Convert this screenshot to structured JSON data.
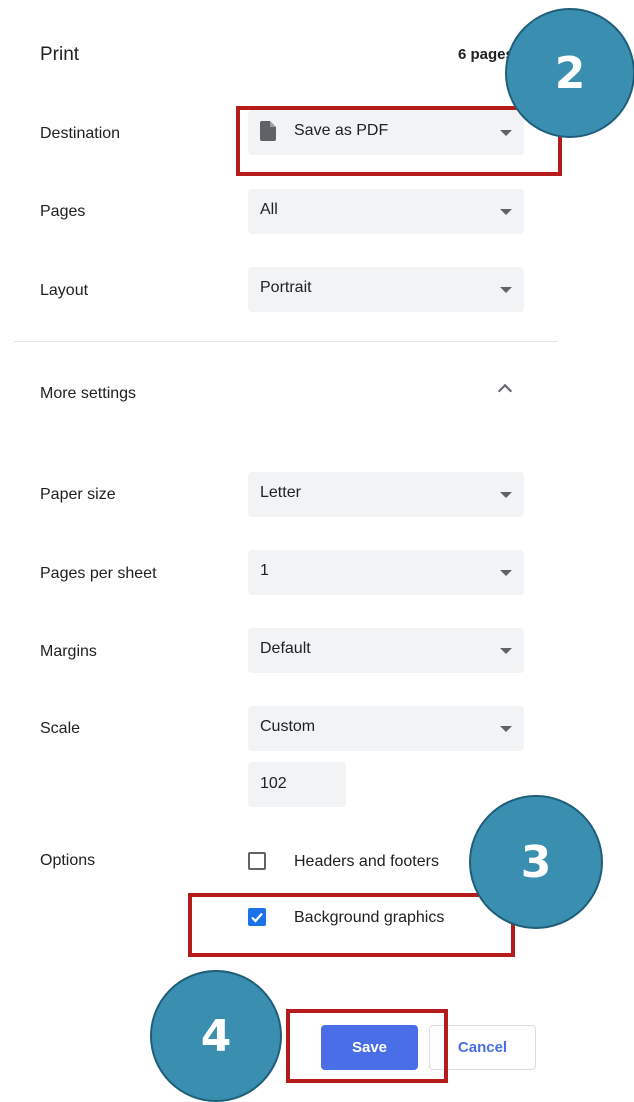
{
  "header": {
    "title": "Print",
    "page_count": "6 pages"
  },
  "destination": {
    "label": "Destination",
    "value": "Save as PDF",
    "icon": "document-icon"
  },
  "pages": {
    "label": "Pages",
    "value": "All"
  },
  "layout": {
    "label": "Layout",
    "value": "Portrait"
  },
  "more_settings": {
    "label": "More settings",
    "icon": "chevron-up-icon"
  },
  "paper_size": {
    "label": "Paper size",
    "value": "Letter"
  },
  "pages_per_sheet": {
    "label": "Pages per sheet",
    "value": "1"
  },
  "margins": {
    "label": "Margins",
    "value": "Default"
  },
  "scale": {
    "label": "Scale",
    "value": "Custom",
    "custom_value": "102"
  },
  "options": {
    "label": "Options",
    "headers_footers": {
      "label": "Headers and footers",
      "checked": false
    },
    "background_graphics": {
      "label": "Background graphics",
      "checked": true
    }
  },
  "buttons": {
    "save": "Save",
    "cancel": "Cancel"
  },
  "callouts": {
    "step2": "2",
    "step3": "3",
    "step4": "4"
  },
  "colors": {
    "highlight": "#b71c1c",
    "bubble": "#3a8fb0",
    "accent": "#4a6ee8"
  }
}
